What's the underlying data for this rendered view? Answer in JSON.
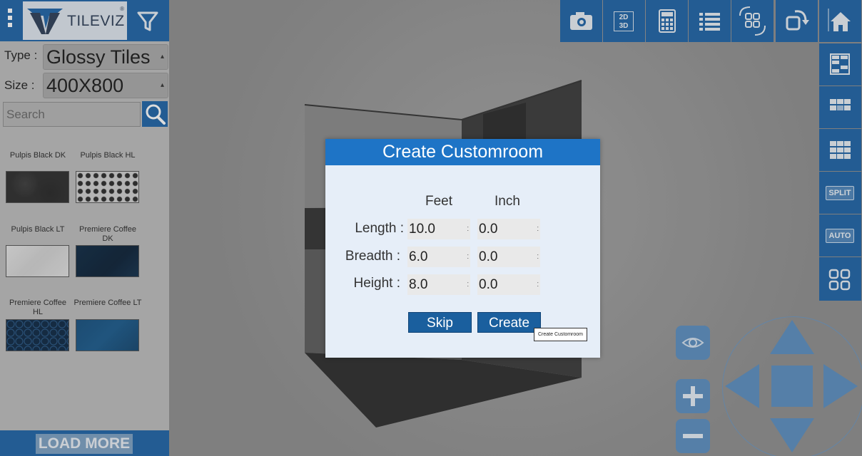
{
  "brand": {
    "name": "TILEVIZ",
    "reg_mark": "®"
  },
  "filters": {
    "type_label": "Type :",
    "type_value": "Glossy Tiles",
    "size_label": "Size :",
    "size_value": "400X800"
  },
  "search": {
    "placeholder": "Search"
  },
  "tiles": [
    {
      "name": "Pulpis Black DK"
    },
    {
      "name": "Pulpis Black HL"
    },
    {
      "name": "Pulpis Black LT"
    },
    {
      "name": "Premiere Coffee DK"
    },
    {
      "name": "Premiere Coffee HL"
    },
    {
      "name": "Premiere Coffee LT"
    }
  ],
  "load_more_label": "LOAD MORE",
  "toolbar": {
    "toggle_2d_3d": [
      "2D",
      "3D"
    ]
  },
  "side_toolbar": {
    "split_label": "SPLIT",
    "auto_label": "AUTO"
  },
  "dialog": {
    "title": "Create Customroom",
    "col_feet": "Feet",
    "col_inch": "Inch",
    "rows": [
      {
        "label": "Length :",
        "feet": "10.0",
        "inch": "0.0"
      },
      {
        "label": "Breadth :",
        "feet": "6.0",
        "inch": "0.0"
      },
      {
        "label": "Height :",
        "feet": "8.0",
        "inch": "0.0"
      }
    ],
    "skip_label": "Skip",
    "create_label": "Create",
    "tooltip": "Create Customroom"
  },
  "colors": {
    "brand_blue": "#1e63a6",
    "dialog_title": "#1e74c6",
    "button": "#1a5f9e"
  }
}
